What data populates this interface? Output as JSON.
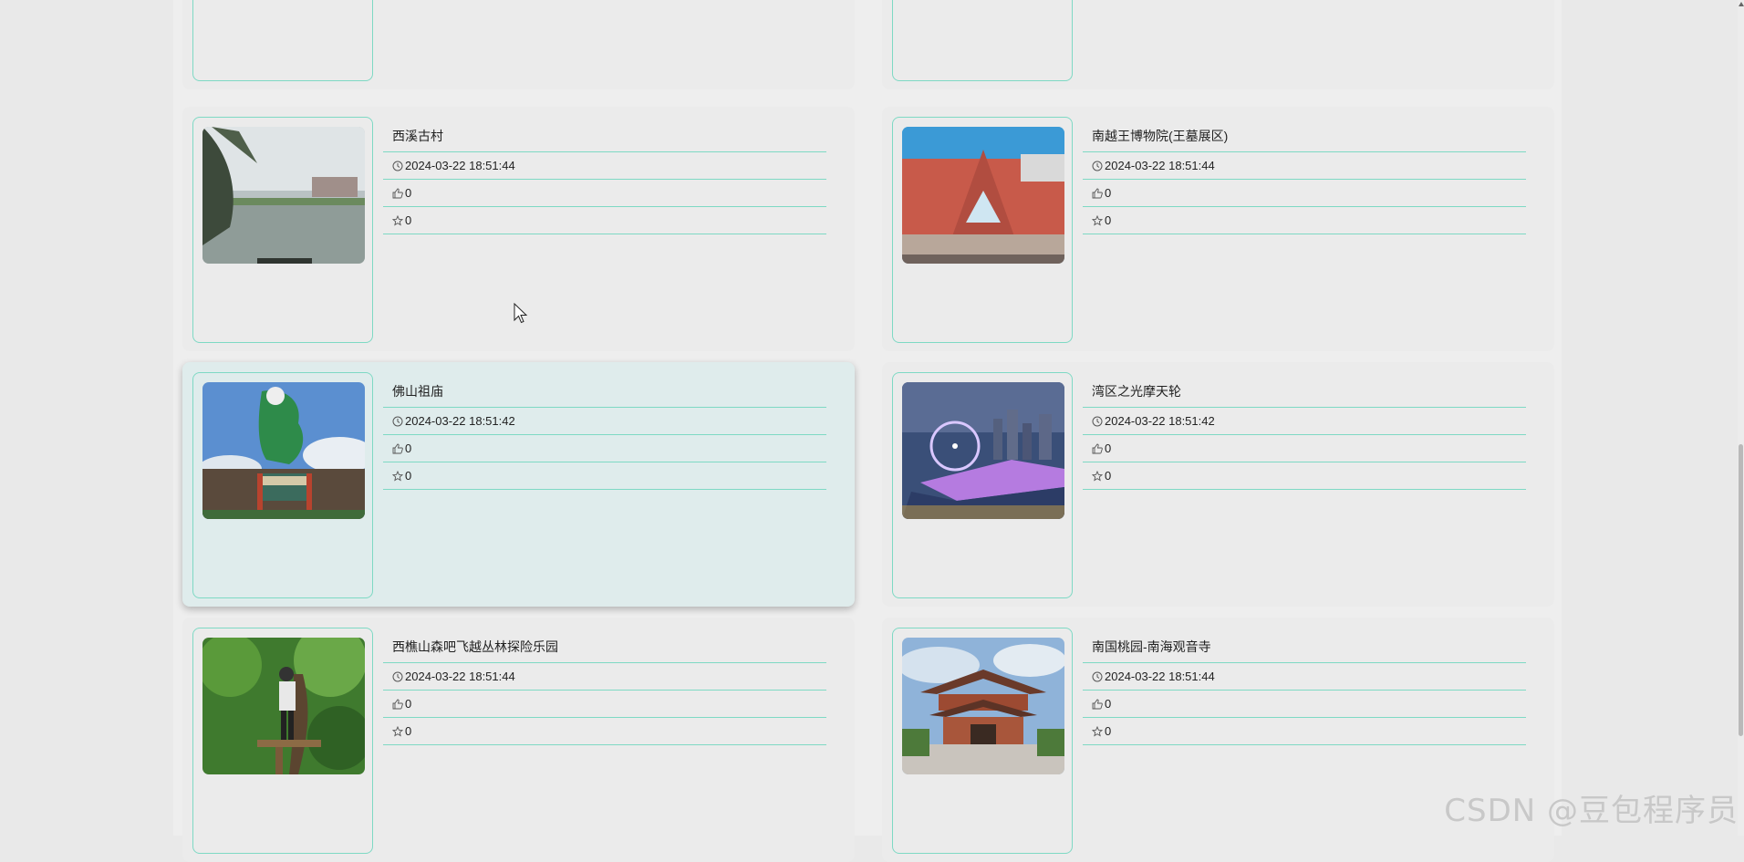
{
  "cards": [
    {
      "title": "",
      "date": "",
      "likes": "",
      "favorites": "",
      "partial": true
    },
    {
      "title": "",
      "date": "",
      "likes": "",
      "favorites": "",
      "partial": true
    },
    {
      "title": "西溪古村",
      "date": "2024-03-22 18:51:44",
      "likes": "0",
      "favorites": "0"
    },
    {
      "title": "南越王博物院(王墓展区)",
      "date": "2024-03-22 18:51:44",
      "likes": "0",
      "favorites": "0"
    },
    {
      "title": "佛山祖庙",
      "date": "2024-03-22 18:51:42",
      "likes": "0",
      "favorites": "0"
    },
    {
      "title": "湾区之光摩天轮",
      "date": "2024-03-22 18:51:42",
      "likes": "0",
      "favorites": "0"
    },
    {
      "title": "西樵山森吧飞越丛林探险乐园",
      "date": "2024-03-22 18:51:44",
      "likes": "0",
      "favorites": "0"
    },
    {
      "title": "南国桃园-南海观音寺",
      "date": "2024-03-22 18:51:44",
      "likes": "0",
      "favorites": "0"
    }
  ],
  "icons": {
    "date": "clock-icon",
    "likes": "thumbs-up-icon",
    "favorites": "star-icon"
  },
  "colors": {
    "accent_border": "#7ed9c4",
    "hover_card": "#dfecec"
  },
  "watermark": "CSDN @豆包程序员"
}
